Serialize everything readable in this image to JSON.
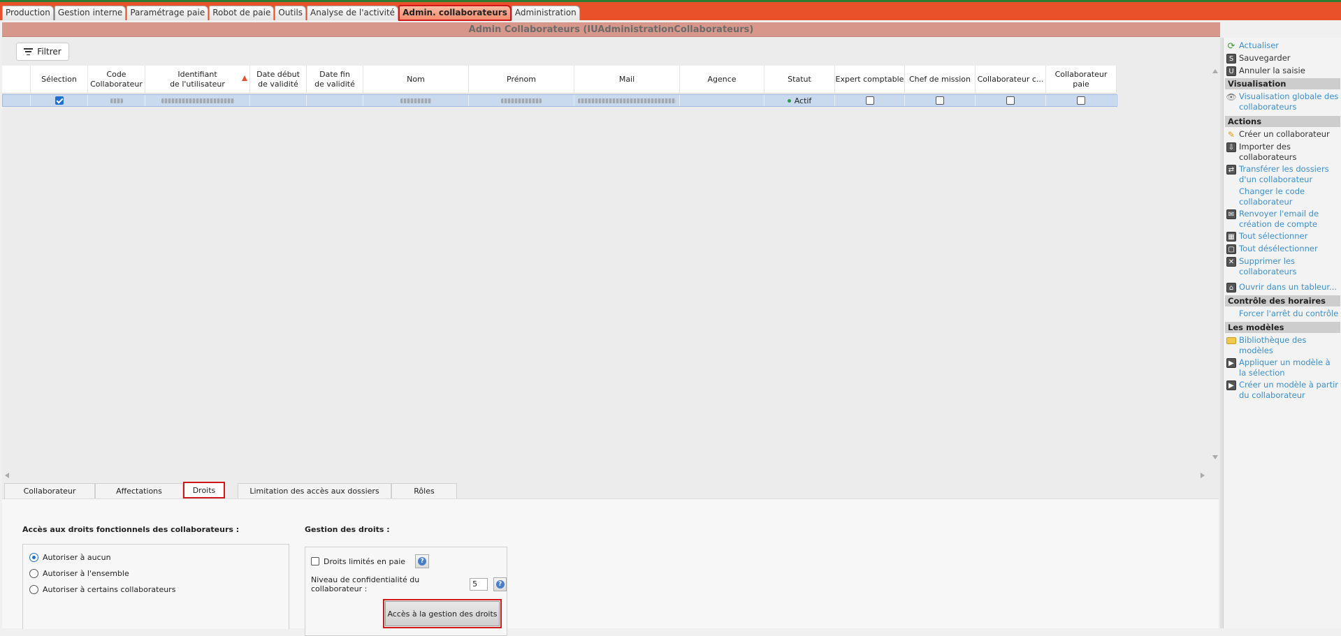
{
  "top_tabs": [
    {
      "label": "Production",
      "active": false
    },
    {
      "label": "Gestion interne",
      "active": false
    },
    {
      "label": "Paramétrage paie",
      "active": false
    },
    {
      "label": "Robot de paie",
      "active": false
    },
    {
      "label": "Outils",
      "active": false
    },
    {
      "label": "Analyse de l'activité",
      "active": false
    },
    {
      "label": "Admin. collaborateurs",
      "active": true
    },
    {
      "label": "Administration",
      "active": false
    }
  ],
  "window_title": "Admin Collaborateurs (IUAdministrationCollaborateurs)",
  "filter_label": "Filtrer",
  "grid": {
    "columns": [
      "",
      "Sélection",
      "Code\nCollaborateur",
      "Identifiant\nde l'utilisateur",
      "Date début\nde validité",
      "Date fin\nde validité",
      "Nom",
      "Prénom",
      "Mail",
      "Agence",
      "Statut",
      "Expert comptable",
      "Chef de mission",
      "Collaborateur c...",
      "Collaborateur paie"
    ],
    "row": {
      "status": "Actif"
    }
  },
  "bottom_tabs": [
    {
      "label": "Collaborateur",
      "active": false
    },
    {
      "label": "Affectations",
      "active": false
    },
    {
      "label": "Droits",
      "active": true
    },
    {
      "label": "Limitation des accès aux dossiers",
      "active": false
    },
    {
      "label": "Rôles",
      "active": false
    }
  ],
  "droits": {
    "access_title": "Accès aux droits fonctionnels des collaborateurs :",
    "radios": [
      {
        "label": "Autoriser à aucun",
        "checked": true
      },
      {
        "label": "Autoriser à l'ensemble",
        "checked": false
      },
      {
        "label": "Autoriser à certains collaborateurs",
        "checked": false
      }
    ],
    "gestion_title": "Gestion des droits :",
    "droits_limites_label": "Droits limités en paie",
    "niveau_label": "Niveau de confidentialité du collaborateur :",
    "niveau_value": "5",
    "access_button": "Accès à la gestion des droits"
  },
  "side": {
    "top_items": [
      "Actualiser",
      "Sauvegarder",
      "Annuler la saisie"
    ],
    "visualisation_title": "Visualisation",
    "visualisation_item": "Visualisation globale des collaborateurs",
    "actions_title": "Actions",
    "actions": [
      "Créer un collaborateur",
      "Importer des collaborateurs",
      "Transférer les dossiers d'un collaborateur",
      "Changer le code collaborateur",
      "Renvoyer l'email de création de compte",
      "Tout sélectionner",
      "Tout désélectionner",
      "Supprimer les collaborateurs"
    ],
    "ouvrir_tableur": "Ouvrir dans un tableur...",
    "controle_title": "Contrôle des horaires",
    "controle_item": "Forcer l'arrêt du contrôle",
    "modeles_title": "Les modèles",
    "modeles": [
      "Bibliothèque des modèles",
      "Appliquer un modèle à la sélection",
      "Créer un modèle à partir du collaborateur"
    ]
  },
  "colors": {
    "accent": "#e8512a",
    "title_bar": "#d7978b",
    "link": "#3b8fd1",
    "highlight": "#d01818"
  }
}
